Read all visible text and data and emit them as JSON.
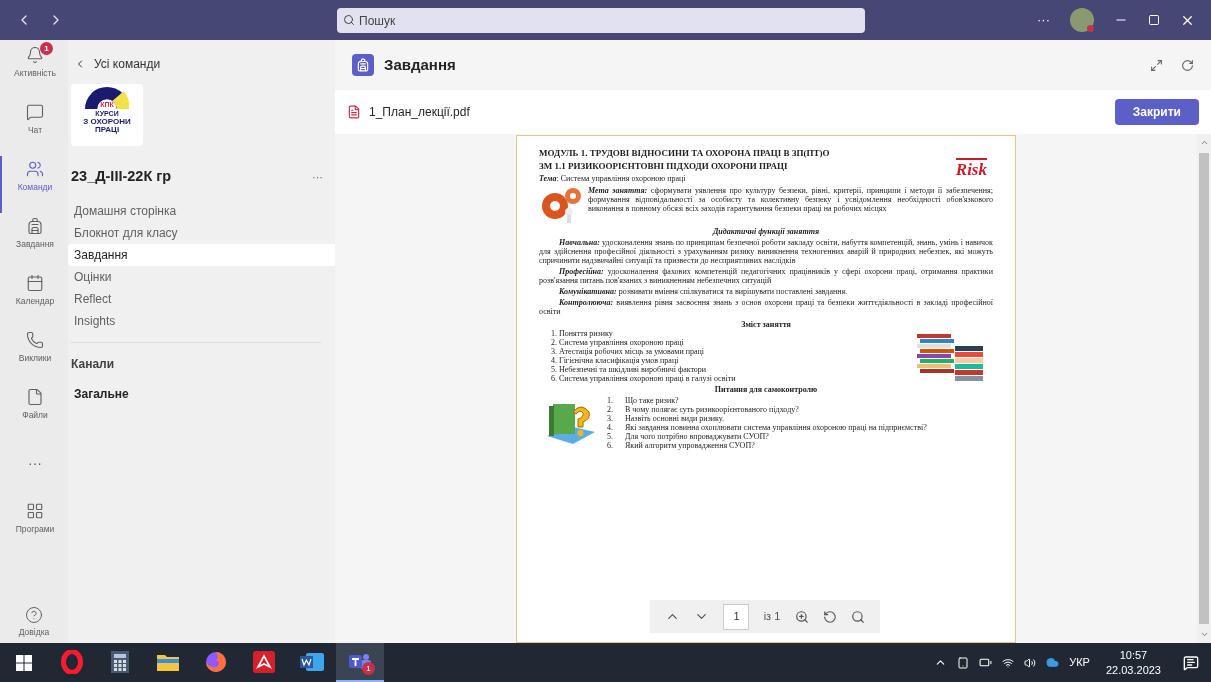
{
  "titlebar": {
    "search": {
      "placeholder": "Пошук"
    },
    "more": "···"
  },
  "rail": [
    {
      "label": "Активність",
      "badge": "1",
      "selected": false
    },
    {
      "label": "Чат",
      "selected": false
    },
    {
      "label": "Команди",
      "selected": true
    },
    {
      "label": "Завдання",
      "selected": false
    },
    {
      "label": "Календар",
      "selected": false
    },
    {
      "label": "Виклики",
      "selected": false
    },
    {
      "label": "Файли",
      "selected": false
    },
    {
      "label": "···",
      "selected": false
    },
    {
      "label": "Програми",
      "selected": false
    }
  ],
  "rail_help": {
    "label": "Довідка"
  },
  "team_panel": {
    "back": "Усі команди",
    "logo": [
      "КПК",
      "КУРСИ",
      "З ОХОРОНИ ПРАЦІ"
    ],
    "team_name": "23_Д-ІІІ-22К гр",
    "more": "···",
    "items": [
      {
        "label": "Домашня сторінка",
        "selected": false
      },
      {
        "label": "Блокнот для класу",
        "selected": false
      },
      {
        "label": "Завдання",
        "selected": true
      },
      {
        "label": "Оцінки",
        "selected": false
      },
      {
        "label": "Reflect",
        "selected": false
      },
      {
        "label": "Insights",
        "selected": false
      }
    ],
    "channels_heading": "Канали",
    "channels": [
      {
        "label": "Загальне"
      }
    ]
  },
  "header": {
    "title": "Завдання"
  },
  "file_bar": {
    "name": "1_План_лекції.pdf",
    "close": "Закрити"
  },
  "document": {
    "heading": "МОДУЛЬ 1. ТРУДОВІ ВІДНОСИНИ ТА ОХОРОНА ПРАЦІ В ЗП(ПТ)О",
    "subheading": "ЗМ 1.1 РИЗИКООРІЄНТОВНІ ПІДХОДИ ОХОРОНИ ПРАЦІ",
    "risk_art": "Risk",
    "topic": "**Тема**: Система управління охороною праці",
    "goal": "**Мета заняття:** сформувати уявлення про культуру безпеки, рівні, критерії, принципи і методи її забезпечення; формування відповідальності за особисту та колективну безпеку і усвідомлення необхідності обов'язкового виконання в повному обсязі всіх заходів гарантування безпеки праці на робочих місцях",
    "functions_heading": "Дидактичні функції заняття",
    "functions": [
      "**Навчальна:** удосконалення знань по принципам безпечної роботи закладу освіти, набуття компетенцій, знань, умінь і навичок для здійснення професійної діяльності з урахуванням ризику виникнення техногенних аварій й природних небезпек, які можуть спричинити надзвичайні ситуації та призвести до несприятливих наслідків",
      "**Професійна:** удосконалення фахових компетенцій педагогічних працівників у сфері охорони праці, отримання практики розв'язання питань пов'язаних з виникненням небезпечних ситуацій",
      "**Комунікативна:** розвивати вміння спілкуватися та вирішувати поставлені завдання.",
      "**Контролююча:** виявлення рівня засвоєння знань з основ охорони праці та безпеки життєдіяльності в закладі професійної освіти"
    ],
    "contents_heading": "Зміст заняття",
    "contents": [
      "1. Поняття ризику",
      "2. Система управління охороною праці",
      "3. Атестація робочих місць за умовами праці",
      "4. Гігієнічна класифікація умов праці",
      "5. Небезпечні та шкідливі виробничі фактори",
      "6. Система управління охороною праці в галузі освіти"
    ],
    "questions_heading": "Питання для самоконтролю",
    "questions": [
      {
        "number": "1.",
        "text": "Що таке ризик?"
      },
      {
        "number": "2.",
        "text": "В чому полягає суть ризикоорієнтованого підходу?"
      },
      {
        "number": "3.",
        "text": "Назвіть основні види ризику."
      },
      {
        "number": "4.",
        "text": "Які завдання повинна охоплювати система управління охороною праці на підприємстві?"
      },
      {
        "number": "5.",
        "text": "Для чого потрібно впроваджувати СУОП?"
      },
      {
        "number": "6.",
        "text": "Який алгоритм упровадження СУОП?"
      }
    ]
  },
  "pdf_toolbar": {
    "page": "1",
    "of": "із 1"
  },
  "taskbar": {
    "apps": [
      {
        "selected": false
      },
      {
        "selected": false
      },
      {
        "selected": false
      },
      {
        "selected": false
      },
      {
        "selected": false
      },
      {
        "selected": false
      },
      {
        "selected": true,
        "badge": "1"
      }
    ],
    "language": "УКР",
    "time": "10:57",
    "date": "22.03.2023"
  }
}
